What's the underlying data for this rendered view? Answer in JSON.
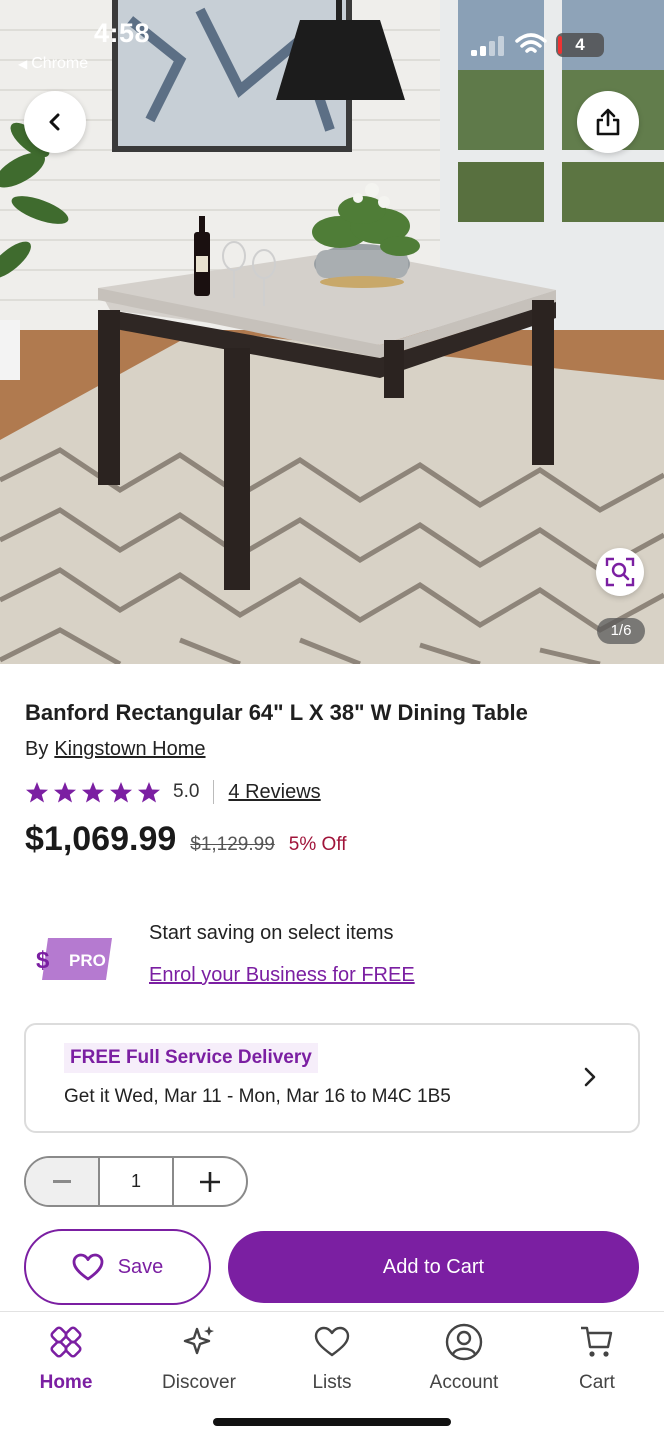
{
  "status_bar": {
    "time": "4:58",
    "back_app": "Chrome",
    "battery": "4"
  },
  "image": {
    "counter": "1/6"
  },
  "product": {
    "title": "Banford Rectangular 64\" L X 38\" W Dining Table",
    "by_prefix": "By",
    "brand": "Kingstown Home",
    "rating": "5.0",
    "stars": 5,
    "reviews": "4 Reviews",
    "price": "$1,069.99",
    "was_price": "$1,129.99",
    "discount": "5% Off"
  },
  "pro": {
    "badge": "PRO",
    "line1": "Start saving on select items",
    "link": "Enrol your Business for FREE"
  },
  "delivery": {
    "tag": "FREE Full Service Delivery",
    "detail": "Get it Wed, Mar 11 - Mon, Mar 16 to M4C 1B5"
  },
  "quantity": {
    "value": "1"
  },
  "actions": {
    "save": "Save",
    "add_to_cart": "Add to Cart"
  },
  "nav": [
    {
      "label": "Home",
      "icon": "home-icon",
      "active": true
    },
    {
      "label": "Discover",
      "icon": "sparkle-icon",
      "active": false
    },
    {
      "label": "Lists",
      "icon": "heart-icon",
      "active": false
    },
    {
      "label": "Account",
      "icon": "account-icon",
      "active": false
    },
    {
      "label": "Cart",
      "icon": "cart-icon",
      "active": false
    }
  ],
  "colors": {
    "brand": "#7b1fa2",
    "sale": "#a0143a"
  }
}
